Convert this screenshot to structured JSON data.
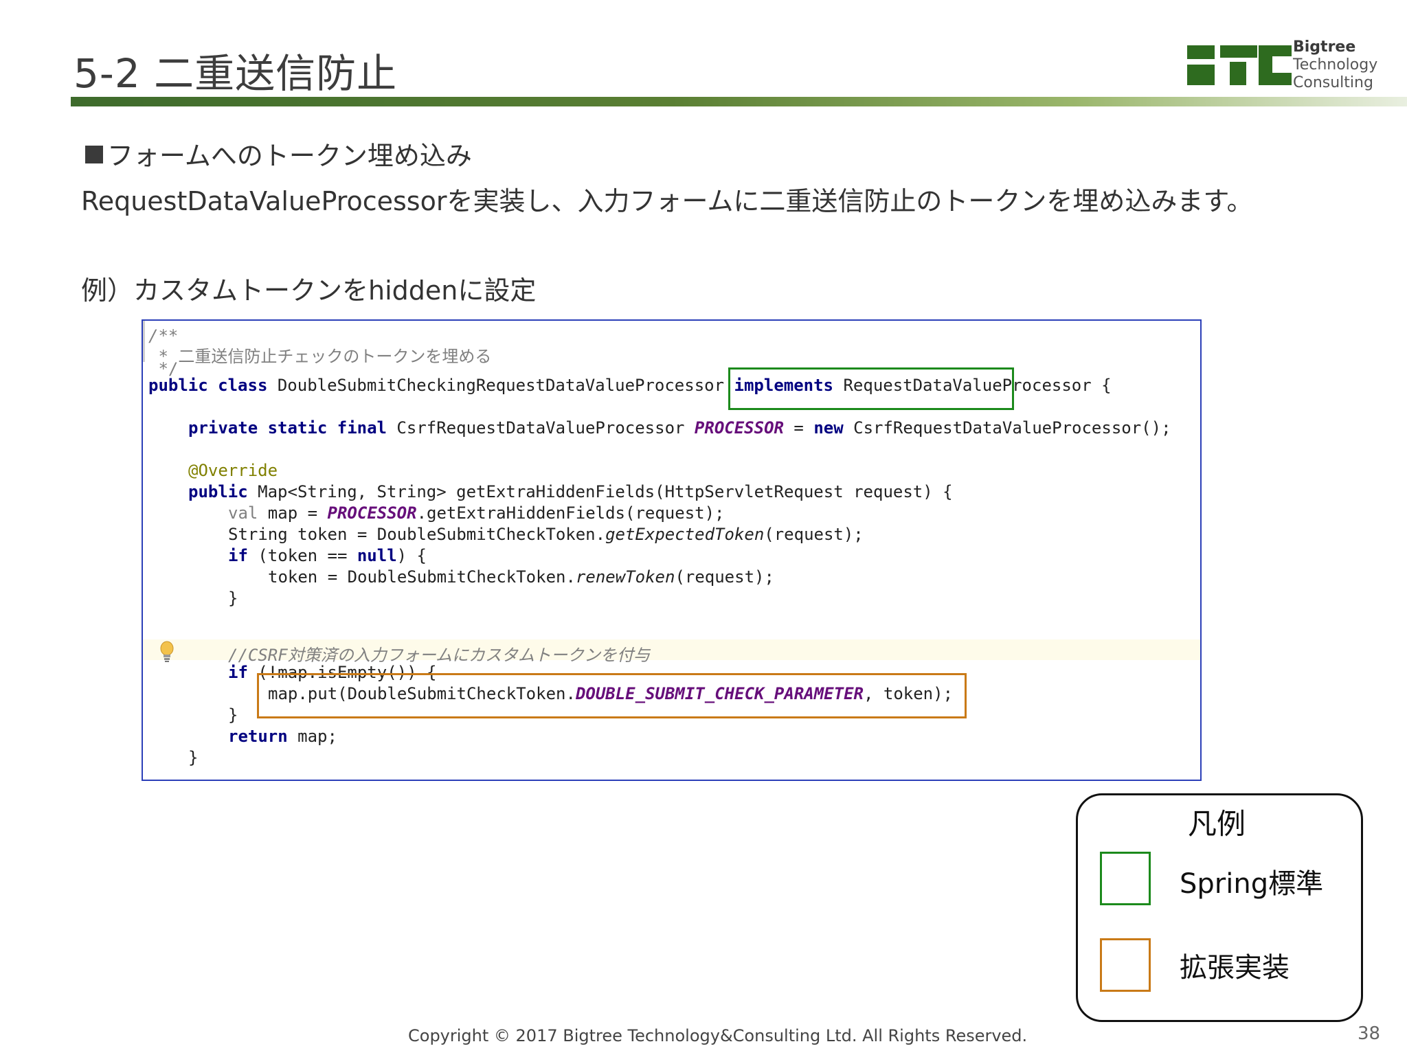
{
  "slide": {
    "title": "5-2 二重送信防止",
    "logo": {
      "line1": "Bigtree",
      "line2": "Technology",
      "line3": "Consulting"
    },
    "heading": "フォームへのトークン埋め込み",
    "description": "RequestDataValueProcessorを実装し、入力フォームに二重送信防止のトークンを埋め込みます。",
    "example": "例）カスタムトークンをhiddenに設定",
    "footer": "Copyright © 2017 Bigtree Technology&Consulting Ltd. All Rights Reserved.",
    "page_number": "38"
  },
  "legend": {
    "title": "凡例",
    "items": [
      {
        "label": "Spring標準",
        "color": "#1c8a1c"
      },
      {
        "label": "拡張実装",
        "color": "#c97a17"
      }
    ]
  },
  "code": {
    "l1": "/**",
    "l2": " * 二重送信防止チェックのトークンを埋める",
    "l3": " */",
    "l4_kw": "public class",
    "l4_name": " DoubleSubmitCheckingRequestDataValueProcessor ",
    "l4_impl": "implements",
    "l4_iface": " RequestDataValueProcessor ",
    "l4_brace": "{",
    "l5_kw": "private static final",
    "l5_type": " CsrfRequestDataValueProcessor ",
    "l5_const": "PROCESSOR",
    "l5_eq": " = ",
    "l5_new": "new",
    "l5_rest": " CsrfRequestDataValueProcessor();",
    "l6": "@Override",
    "l7_kw": "public",
    "l7_rest": " Map<String, String> getExtraHiddenFields(HttpServletRequest request) {",
    "l8_val": "val",
    "l8_a": " map = ",
    "l8_const": "PROCESSOR",
    "l8_b": ".getExtraHiddenFields(request);",
    "l9_a": "String token = DoubleSubmitCheckToken.",
    "l9_it": "getExpectedToken",
    "l9_b": "(request);",
    "l10_if": "if",
    "l10_a": " (token == ",
    "l10_null": "null",
    "l10_b": ") {",
    "l11_a": "token = DoubleSubmitCheckToken.",
    "l11_it": "renewToken",
    "l11_b": "(request);",
    "l12": "}",
    "l13": "//CSRF対策済の入力フォームにカスタムトークンを付与",
    "l14_if": "if",
    "l14_rest": " (!map.isEmpty()) {",
    "l15_a": "map.put(DoubleSubmitCheckToken.",
    "l15_const": "DOUBLE_SUBMIT_CHECK_PARAMETER",
    "l15_b": ", token);",
    "l16": "}",
    "l17_kw": "return",
    "l17_rest": " map;",
    "l18": "}"
  }
}
